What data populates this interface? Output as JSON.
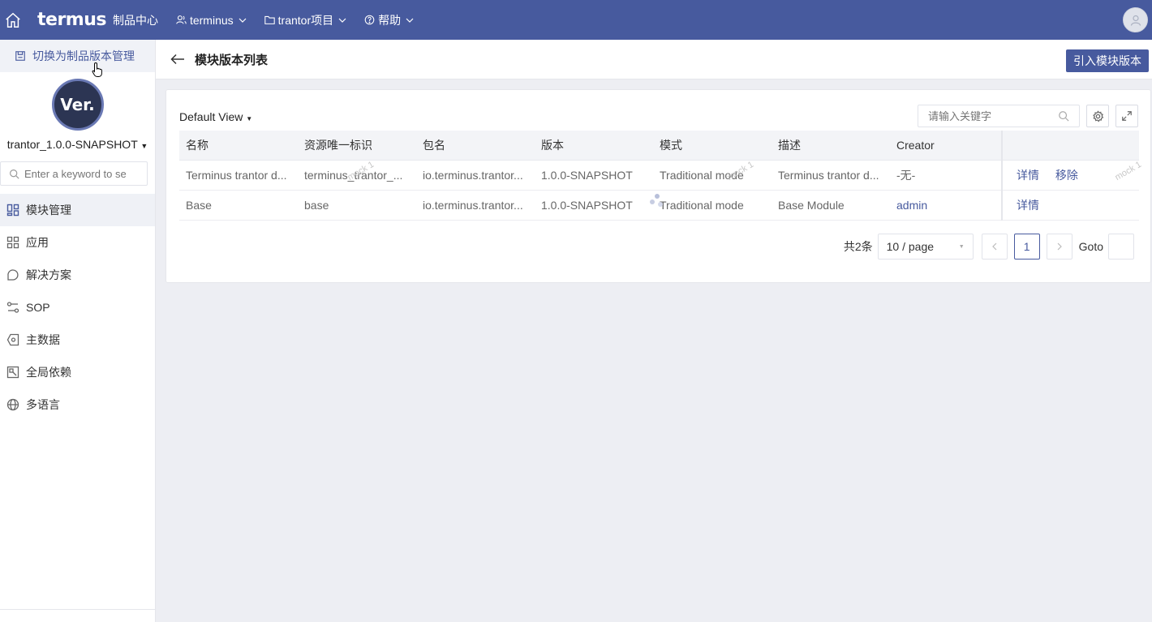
{
  "topbar": {
    "logo": "termus",
    "product": "制品中心",
    "nav": [
      {
        "label": "terminus",
        "icon": "users-icon"
      },
      {
        "label": "trantor项目",
        "icon": "folder-icon"
      },
      {
        "label": "帮助",
        "icon": "help-circle-icon"
      }
    ]
  },
  "sidebar": {
    "switch_label": "切换为制品版本管理",
    "logo_text": "Ver.",
    "version": "trantor_1.0.0-SNAPSHOT",
    "search_placeholder": "Enter a keyword to se",
    "menu": [
      {
        "label": "模块管理",
        "icon": "module-icon",
        "active": true
      },
      {
        "label": "应用",
        "icon": "apps-icon"
      },
      {
        "label": "解决方案",
        "icon": "solution-icon"
      },
      {
        "label": "SOP",
        "icon": "sop-icon"
      },
      {
        "label": "主数据",
        "icon": "master-data-icon"
      },
      {
        "label": "全局依赖",
        "icon": "dependency-icon"
      },
      {
        "label": "多语言",
        "icon": "globe-icon"
      }
    ]
  },
  "header": {
    "title": "模块版本列表",
    "import_button": "引入模块版本"
  },
  "card": {
    "view": "Default View",
    "search_placeholder": "请输入关键字",
    "columns": [
      "名称",
      "资源唯一标识",
      "包名",
      "版本",
      "模式",
      "描述",
      "Creator"
    ],
    "rows": [
      {
        "name": "Terminus trantor d...",
        "key": "terminus_trantor_...",
        "package": "io.terminus.trantor...",
        "version": "1.0.0-SNAPSHOT",
        "mode": "Traditional mode",
        "desc": "Terminus trantor d...",
        "creator": "-无-",
        "actions": [
          "详情",
          "移除"
        ]
      },
      {
        "name": "Base",
        "key": "base",
        "package": "io.terminus.trantor...",
        "version": "1.0.0-SNAPSHOT",
        "mode": "Traditional mode",
        "desc": "Base Module",
        "creator": "admin",
        "actions": [
          "详情"
        ]
      }
    ],
    "pager": {
      "total": "共2条",
      "page_size": "10 / page",
      "current": "1",
      "goto": "Goto"
    },
    "watermark": "mock 1"
  }
}
